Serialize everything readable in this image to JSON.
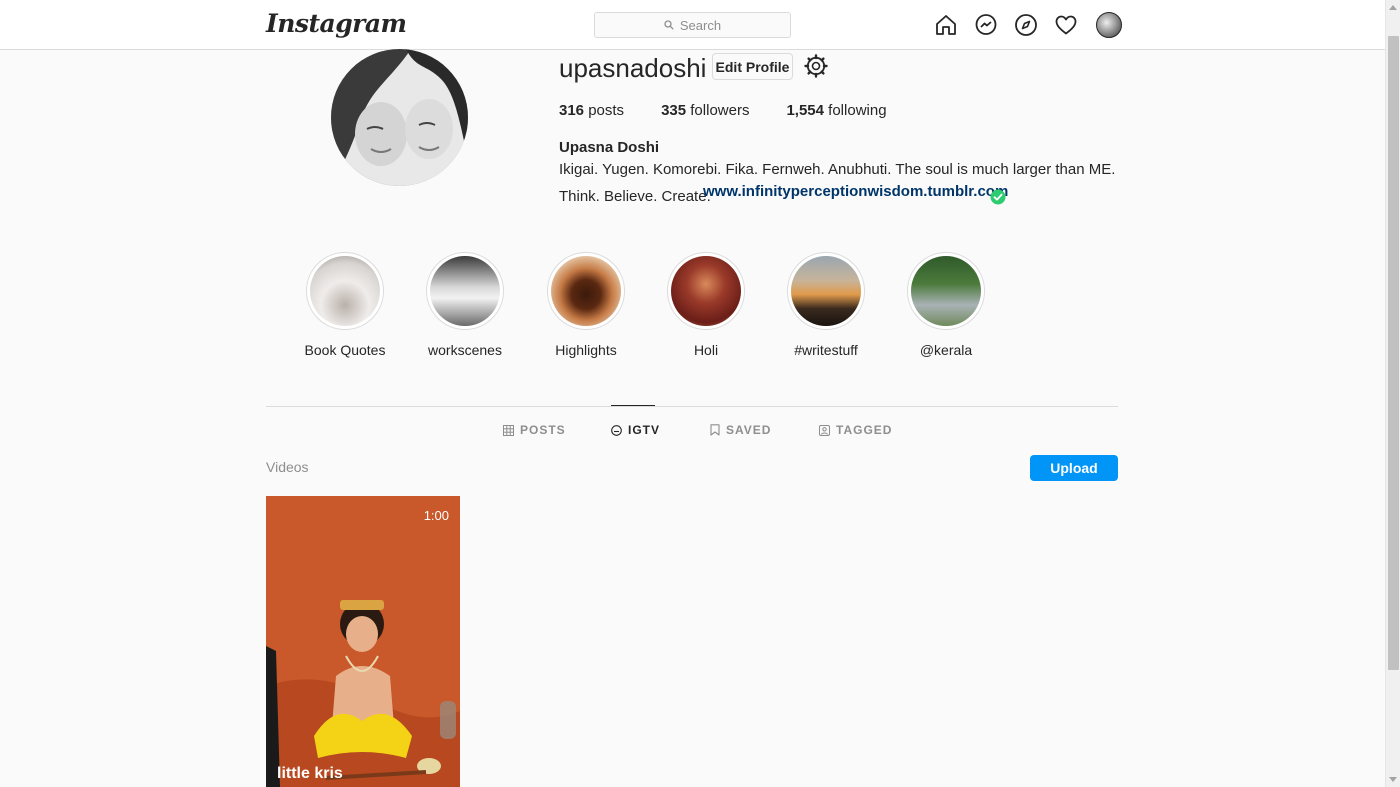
{
  "nav": {
    "logo": "Instagram",
    "search_placeholder": "Search",
    "icons": [
      "home-icon",
      "messenger-icon",
      "explore-icon",
      "activity-heart-icon",
      "profile-avatar"
    ]
  },
  "profile": {
    "username": "upasnadoshi",
    "edit_label": "Edit Profile",
    "posts_count": "316",
    "posts_label": "posts",
    "followers_count": "335",
    "followers_label": "followers",
    "following_count": "1,554",
    "following_label": "following",
    "full_name": "Upasna Doshi",
    "bio_line1": "Ikigai. Yugen. Komorebi. Fika. Fernweh. Anubhuti. The soul is much larger than ME.",
    "bio_line2": "Think. Believe. Create.",
    "link": "www.infinityperceptionwisdom.tumblr.com"
  },
  "highlights": [
    {
      "label": "Book Quotes"
    },
    {
      "label": "workscenes"
    },
    {
      "label": "Highlights"
    },
    {
      "label": "Holi"
    },
    {
      "label": "#writestuff"
    },
    {
      "label": "@kerala"
    }
  ],
  "tabs": [
    {
      "label": "POSTS",
      "icon": "grid-icon"
    },
    {
      "label": "IGTV",
      "icon": "igtv-icon",
      "active": true
    },
    {
      "label": "SAVED",
      "icon": "bookmark-icon"
    },
    {
      "label": "TAGGED",
      "icon": "tagged-icon"
    }
  ],
  "igtv": {
    "section_label": "Videos",
    "upload_label": "Upload",
    "videos": [
      {
        "title": "little kris",
        "duration": "1:00"
      }
    ]
  },
  "colors": {
    "accent": "#0095f6",
    "link": "#003569",
    "verified": "#2ecc71"
  }
}
